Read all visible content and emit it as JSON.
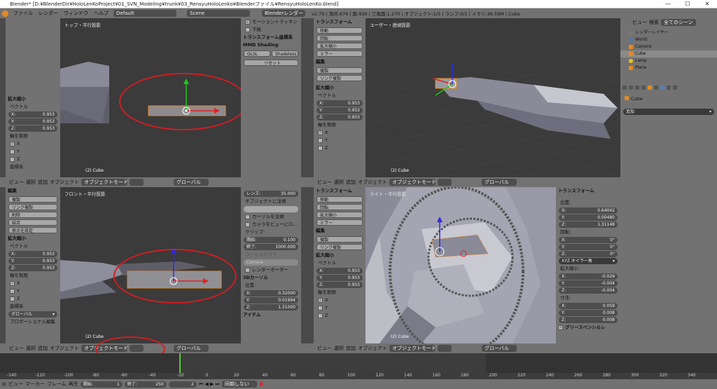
{
  "window": {
    "title": "Blender* [D:¥BlenderDir¥HoloLenKoProject¥01_SVN_Modeling¥trunk¥03_RensyuHoloLenko¥Blenderファイル¥RensyuHoloLenKo.blend]",
    "min": "—",
    "max": "☐",
    "close": "✕"
  },
  "topbar": {
    "menus": [
      "ファイル",
      "レンダー",
      "ウィンドウ",
      "ヘルプ"
    ],
    "layout": "Default",
    "scene": "Scene",
    "engine": "Blenderレンダー",
    "stats": "v2.79 | 頂点:674 | 面:930 | 三角面:1,270 | オブジェクト:1/5 | ランプ:0/1 | メモリ:36.59M | Cube"
  },
  "vp_tl": {
    "title": "トップ・平行投影",
    "footer": "(2) Cube"
  },
  "vp_tr": {
    "title": "ユーザー・透視投影",
    "footer": "(2) Cube"
  },
  "vp_bl": {
    "title": "フロント・平行投影",
    "footer": "(2) Cube"
  },
  "vp_br": {
    "title": "ライト・平行投影",
    "footer": "(2) Cube"
  },
  "left_tl": {
    "header": "拡大縮小",
    "vector": "ベクトル",
    "x": "X:",
    "xv": "0.953",
    "y": "Y:",
    "yv": "0.953",
    "z": "Z:",
    "zv": "0.953",
    "constraint": "軸を制限",
    "cx": "X",
    "cy": "Y",
    "cz": "Z",
    "coord": "座標系"
  },
  "props_top": {
    "motion": "モーショントラッキン",
    "bg": "下絵",
    "transform": "トランスフォーム座標系",
    "mmd": "MMD Shading",
    "glsl": "GLSL",
    "shadeless": "Shadeless",
    "reset": "リセット"
  },
  "tools_tr": {
    "header": "トランスフォーム",
    "move": "移動",
    "rotate": "回転",
    "scale": "拡大縮小",
    "mirror": "ミラー",
    "edit": "編集",
    "copy": "複製",
    "link": "リンク複製"
  },
  "left_tr": {
    "header": "拡大縮小",
    "vector": "ベクトル",
    "x": "X:",
    "xv": "0.953",
    "y": "Y:",
    "yv": "0.953",
    "z": "Z:",
    "zv": "0.953",
    "constraint": "軸を制限",
    "cx": "X",
    "cy": "Y",
    "cz": "Z"
  },
  "tools_bl": {
    "header": "編集",
    "copy": "複製",
    "link": "リンク複製",
    "delete": "削除",
    "join": "結合",
    "origin": "原点を設定",
    "scale_header": "拡大縮小",
    "vector": "ベクトル",
    "x": "X:",
    "xv": "0.953",
    "y": "Y:",
    "yv": "0.953",
    "z": "Z:",
    "zv": "0.953",
    "constraint": "軸を制限",
    "cx": "X",
    "cy": "Y",
    "cz": "Z",
    "coord": "座標系",
    "coord_val": "グローバル",
    "proportional": "プロポーショナル編集"
  },
  "view_props_bl": {
    "lens": "レンズ:",
    "lens_v": "35.000",
    "lock": "オブジェクトに注視",
    "lock_cursor": "カーソルを注視",
    "lock_camera": "カメラをビューにロ...",
    "clip": "クリップ:",
    "start": "開始:",
    "start_v": "0.100",
    "end": "終了:",
    "end_v": "1000.000",
    "local_cam": "ローカルカメラ",
    "camera": "Camera",
    "render_border": "レンダーボーダー",
    "cursor": "3Dカーソル",
    "pos": "位置:",
    "x": "X:",
    "xv": "0.32000",
    "y": "Y:",
    "yv": "0.01994",
    "z": "Z:",
    "zv": "1.31000",
    "item": "アイテム"
  },
  "tools_br": {
    "header": "トランスフォーム",
    "move": "移動",
    "rotate": "回転",
    "scale": "拡大縮小",
    "mirror": "ミラー",
    "edit": "編集",
    "copy": "複製",
    "link": "リンク複製",
    "scale_header": "拡大縮小",
    "vector": "ベクトル",
    "x": "X:",
    "xv": "0.953",
    "y": "Y:",
    "yv": "0.953",
    "z": "Z:",
    "zv": "0.953",
    "constraint": "軸を制限",
    "cx": "X",
    "cy": "Y",
    "cz": "Z"
  },
  "n_br": {
    "header": "トランスフォーム",
    "location": "位置:",
    "lx": "X:",
    "lxv": "0.64042",
    "ly": "Y:",
    "lyv": "0.00480",
    "lz": "Z:",
    "lzv": "1.31148",
    "rotation": "回転:",
    "rx": "X:",
    "rxv": "0°",
    "ry": "Y:",
    "ryv": "0°",
    "rz": "Z:",
    "rzv": "0°",
    "mode": "XYZ オイラー角",
    "scale": "拡大縮小:",
    "sx": "X:",
    "sxv": "-0.029",
    "sy": "Y:",
    "syv": "-0.004",
    "sz": "Z:",
    "szv": "-0.004",
    "dims": "寸法:",
    "dx": "X:",
    "dxv": "0.059",
    "dy": "Y:",
    "dyv": "0.008",
    "dz": "Z:",
    "dzv": "0.008",
    "grease": "グリースペンシルレ"
  },
  "vpbar": {
    "view": "ビュー",
    "select": "選択",
    "add": "追加",
    "object": "オブジェクト",
    "mode": "オブジェクトモード",
    "orient": "グローバル"
  },
  "outliner": {
    "view": "ビュー",
    "search": "検索",
    "scenes": "全てのシーン",
    "items": [
      "レンダーレイヤー",
      "World",
      "Camera",
      "Cube",
      "Lamp",
      "Plane"
    ]
  },
  "props": {
    "object": "Cube",
    "add": "追加"
  },
  "timeline": {
    "ticks": [
      "-140",
      "-120",
      "-100",
      "-80",
      "-60",
      "-40",
      "-20",
      "0",
      "20",
      "40",
      "60",
      "80",
      "100",
      "120",
      "140",
      "160",
      "180",
      "200",
      "220",
      "240",
      "260",
      "280",
      "300",
      "320",
      "340"
    ],
    "view": "ビュー",
    "marker": "マーカー",
    "frame": "フレーム",
    "play": "再生",
    "start": "開始:",
    "start_v": "1",
    "end": "終了:",
    "end_v": "250",
    "current": "2",
    "sync": "同期しない"
  },
  "colors": {
    "ellipse": "#d21e22",
    "header": "#727272",
    "viewport": "#3b3b3b",
    "orange": "#e58a22",
    "axis_red": "#e02020",
    "axis_green": "#1ec81e",
    "axis_blue": "#2a2ae8"
  }
}
